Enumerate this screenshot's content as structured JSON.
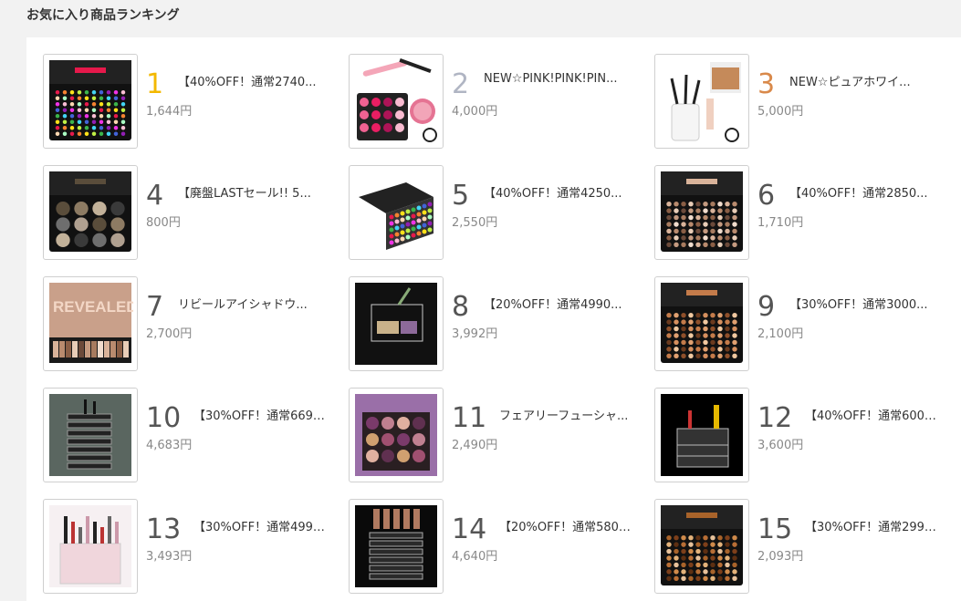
{
  "page": {
    "title": "お気に入り商品ランキング"
  },
  "items": [
    {
      "rank": "1",
      "name": "【40%OFF！通常2740...",
      "price": "1,644円",
      "icon": "rainbow-palette-icon"
    },
    {
      "rank": "2",
      "name": "NEW☆PINK!PINK!PIN...",
      "price": "4,000円",
      "icon": "pink-kit-icon"
    },
    {
      "rank": "3",
      "name": "NEW☆ピュアホワイ...",
      "price": "5,000円",
      "icon": "white-brush-set-icon"
    },
    {
      "rank": "4",
      "name": "【廃盤LASTセール!! 5...",
      "price": "800円",
      "icon": "smoky-palette-icon"
    },
    {
      "rank": "5",
      "name": "【40%OFF！通常4250...",
      "price": "2,550円",
      "icon": "open-palette-icon"
    },
    {
      "rank": "6",
      "name": "【40%OFF！通常2850...",
      "price": "1,710円",
      "icon": "nude-palette-icon"
    },
    {
      "rank": "7",
      "name": "リビールアイシャドウ...",
      "price": "2,700円",
      "icon": "revealed-palette-icon"
    },
    {
      "rank": "8",
      "name": "【20%OFF！通常4990...",
      "price": "3,992円",
      "icon": "acrylic-case-icon"
    },
    {
      "rank": "9",
      "name": "【30%OFF！通常3000...",
      "price": "2,100円",
      "icon": "warm-palette-icon"
    },
    {
      "rank": "10",
      "name": "【30%OFF！通常6690...",
      "price": "4,683円",
      "icon": "rotating-tower-icon"
    },
    {
      "rank": "11",
      "name": "フェアリーフューシャ...",
      "price": "2,490円",
      "icon": "fuchsia-palette-icon"
    },
    {
      "rank": "12",
      "name": "【40%OFF！通常6000...",
      "price": "3,600円",
      "icon": "drawer-organizer-icon"
    },
    {
      "rank": "13",
      "name": "【30%OFF！通常4990...",
      "price": "3,493円",
      "icon": "clear-organizer-icon"
    },
    {
      "rank": "14",
      "name": "【20%OFF！通常5800...",
      "price": "4,640円",
      "icon": "lipstick-tower-icon"
    },
    {
      "rank": "15",
      "name": "【30%OFF！通常2990...",
      "price": "2,093円",
      "icon": "bronze-palette-icon"
    }
  ]
}
